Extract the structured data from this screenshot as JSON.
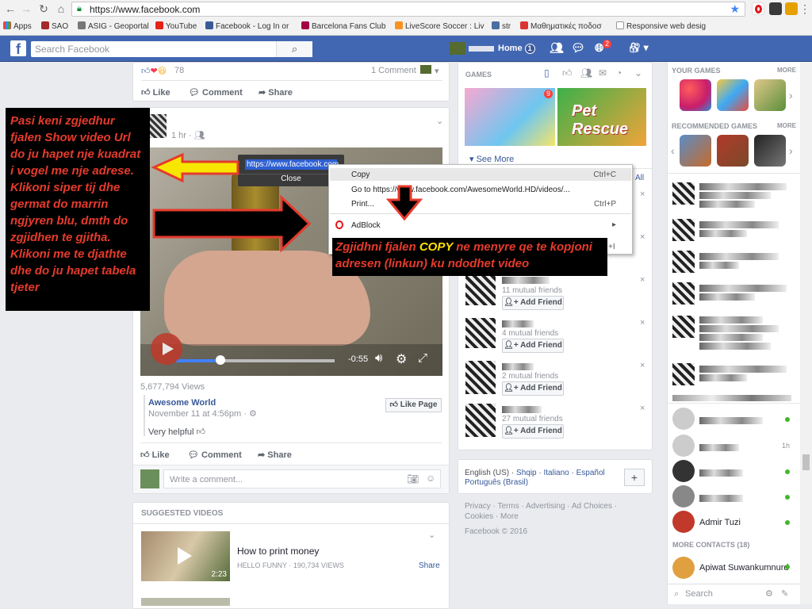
{
  "browser": {
    "url": "https://www.facebook.com",
    "bookmarks": [
      "Apps",
      "SAO",
      "ASIG - Geoportal",
      "YouTube",
      "Facebook - Log In or",
      "Barcelona Fans Club",
      "LiveScore Soccer : Liv",
      "str",
      "Μαθηματικές ποδοσ",
      "Responsive web desig"
    ]
  },
  "fb": {
    "search_placeholder": "Search Facebook",
    "home_label": "Home",
    "home_badge": "1",
    "notif_badge": "2"
  },
  "post1": {
    "reactions_count": "78",
    "comments": "1 Comment",
    "like": "Like",
    "comment": "Comment",
    "share": "Share"
  },
  "post2": {
    "time": "1 hr",
    "tooltip_url": "https://www.facebook.com",
    "tooltip_close": "Close",
    "video_time": "-0:55",
    "views": "5,677,794 Views",
    "page_name": "Awesome World",
    "page_date": "November 11 at 4:56pm",
    "like_page": "Like Page",
    "helpful": "Very helpful",
    "like": "Like",
    "comment": "Comment",
    "share": "Share",
    "write_comment": "Write a comment..."
  },
  "context_menu": {
    "copy": "Copy",
    "copy_key": "Ctrl+C",
    "goto": "Go to https://www.facebook.com/AwesomeWorld.HD/videos/...",
    "print": "Print...",
    "print_key": "Ctrl+P",
    "adblock": "AdBlock"
  },
  "notes": {
    "left": "Pasi keni zgjedhur fjalen Show video Url do ju hapet nje kuadrat i vogel me nje adrese. Klikoni siper tij dhe germat do marrin ngjyren blu, dmth do zgjidhen te gjitha. Klikoni me te djathte dhe do ju hapet tabela tjeter",
    "right_pre": "Zgjidhni fjalen",
    "right_copy": "COPY",
    "right_post": "ne menyre qe te kopjoni adresen (linkun) ku ndodhet video"
  },
  "suggested": {
    "header": "SUGGESTED VIDEOS",
    "title": "How to print money",
    "channel": "HELLO FUNNY · 190,734 VIEWS",
    "duration": "2:23",
    "share": "Share"
  },
  "games_panel": {
    "header": "GAMES",
    "see_more": "See More",
    "badge": "9",
    "game2": "Pet Rescue"
  },
  "suggestions": [
    {
      "mutual": "11 mutual friends",
      "add": "Add Friend"
    },
    {
      "mutual": "4 mutual friends",
      "add": "Add Friend"
    },
    {
      "mutual": "2 mutual friends",
      "add": "Add Friend"
    },
    {
      "mutual": "27 mutual friends",
      "add": "Add Friend"
    }
  ],
  "languages": [
    "English (US)",
    "Shqip",
    "Italiano",
    "Español",
    "Português (Brasil)"
  ],
  "footer": {
    "links": "Privacy · Terms · Advertising · Ad Choices · Cookies · More",
    "copyright": "Facebook © 2016"
  },
  "sidebar": {
    "your_games": "YOUR GAMES",
    "more": "MORE",
    "recommended": "RECOMMENDED GAMES",
    "more_contacts": "MORE CONTACTS (18)",
    "contact_named": "Admir Tuzi",
    "contact_more": "Apiwat Suwankumnurd",
    "ticker_time": "1h",
    "search": "Search"
  }
}
